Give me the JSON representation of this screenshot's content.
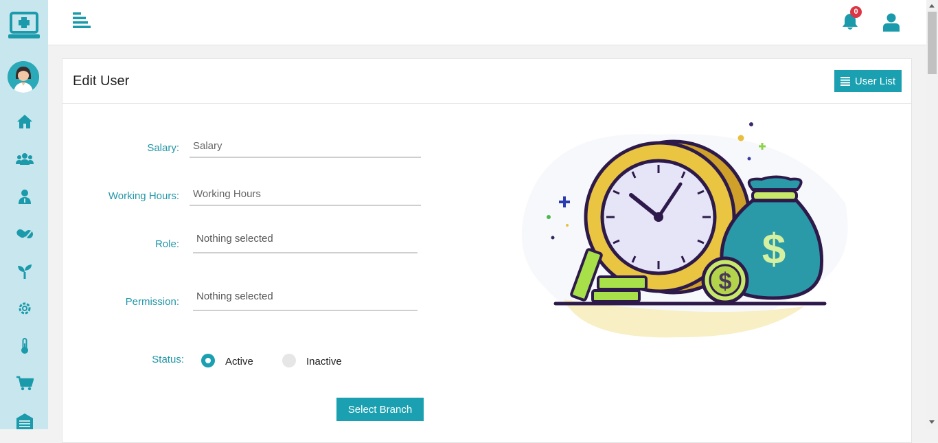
{
  "header": {
    "notifications_count": "0"
  },
  "card": {
    "title": "Edit User",
    "user_list_button": "User List"
  },
  "form": {
    "salary": {
      "label": "Salary:",
      "placeholder": "Salary",
      "value": ""
    },
    "working_hours": {
      "label": "Working Hours:",
      "placeholder": "Working Hours",
      "value": ""
    },
    "role": {
      "label": "Role:",
      "selected": "Nothing selected"
    },
    "permission": {
      "label": "Permission:",
      "selected": "Nothing selected"
    },
    "status": {
      "label": "Status:",
      "options": [
        "Active",
        "Inactive"
      ],
      "selected": "Active"
    },
    "select_branch_button": "Select Branch"
  },
  "sidebar": {
    "icons": [
      "home-icon",
      "users-icon",
      "doctor-icon",
      "pills-icon",
      "seedling-icon",
      "gear-icon",
      "thermometer-icon",
      "cart-icon",
      "warehouse-icon"
    ]
  },
  "colors": {
    "accent": "#1aa0b0",
    "sidebar_bg": "#c8e6ee",
    "label": "#2196a8",
    "badge": "#dc3545"
  }
}
